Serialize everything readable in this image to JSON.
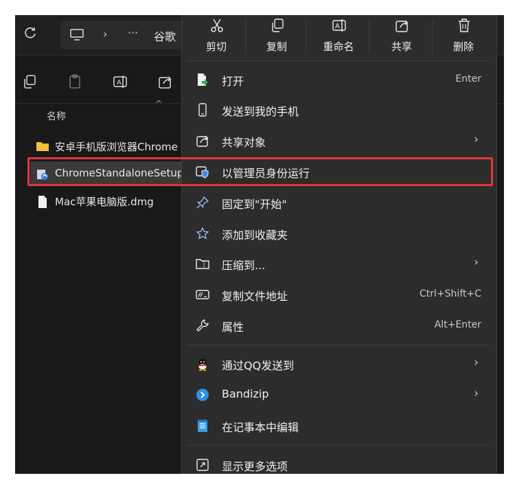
{
  "explorer": {
    "refresh_icon": "refresh-icon",
    "address": {
      "pc_icon": "computer-icon",
      "separator": "›",
      "more": "···",
      "title": "谷歌"
    },
    "commands": [
      "copy-icon",
      "paste-icon",
      "rename-icon",
      "share-icon"
    ],
    "column_header": "名称",
    "sort_caret": "^",
    "files": [
      {
        "name": "安卓手机版浏览器Chrome",
        "icon": "folder-icon"
      },
      {
        "name": "ChromeStandaloneSetup",
        "icon": "installer-icon",
        "selected": true
      },
      {
        "name": "Mac苹果电脑版.dmg",
        "icon": "file-icon"
      }
    ]
  },
  "context_menu": {
    "actions": [
      {
        "label": "剪切",
        "icon": "cut-icon"
      },
      {
        "label": "复制",
        "icon": "copy-icon"
      },
      {
        "label": "重命名",
        "icon": "rename-icon"
      },
      {
        "label": "共享",
        "icon": "share-icon"
      },
      {
        "label": "删除",
        "icon": "delete-icon"
      }
    ],
    "items": [
      {
        "label": "打开",
        "shortcut": "Enter",
        "icon": "open-file-icon"
      },
      {
        "label": "发送到我的手机",
        "icon": "phone-icon"
      },
      {
        "label": "共享对象",
        "icon": "share-icon",
        "submenu": true
      },
      {
        "label": "以管理员身份运行",
        "icon": "admin-shield-icon"
      },
      {
        "label": "固定到\"开始\"",
        "icon": "pin-icon"
      },
      {
        "label": "添加到收藏夹",
        "icon": "star-icon"
      },
      {
        "label": "压缩到...",
        "icon": "zip-folder-icon",
        "submenu": true
      },
      {
        "label": "复制文件地址",
        "shortcut": "Ctrl+Shift+C",
        "icon": "copy-path-icon"
      },
      {
        "label": "属性",
        "shortcut": "Alt+Enter",
        "icon": "wrench-icon"
      },
      {
        "label": "通过QQ发送到",
        "icon": "qq-icon",
        "submenu": true
      },
      {
        "label": "Bandizip",
        "icon": "bandizip-icon",
        "submenu": true
      },
      {
        "label": "在记事本中编辑",
        "icon": "notepad-icon"
      },
      {
        "label": "显示更多选项",
        "icon": "more-options-icon"
      }
    ],
    "chevron": "›",
    "highlight_color": "#e4353a"
  }
}
